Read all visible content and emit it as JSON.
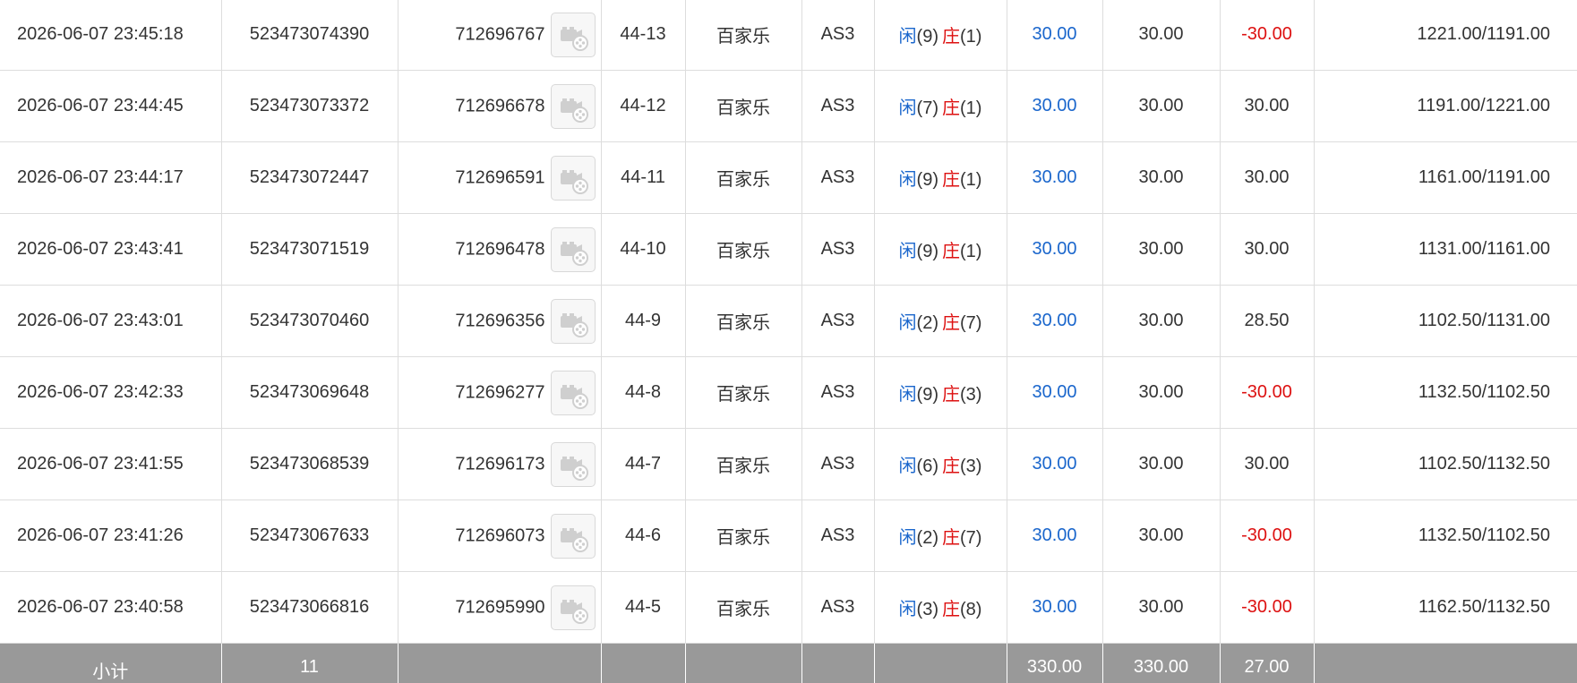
{
  "rows": [
    {
      "time": "2026-06-07 23:45:18",
      "order_no": "523473074390",
      "game_no": "712696767",
      "round": "44-13",
      "game": "百家乐",
      "table": "AS3",
      "result": {
        "player_label": "闲",
        "player_points": "(9)",
        "banker_label": "庄",
        "banker_points": "(1)"
      },
      "bet": "30.00",
      "valid_bet": "30.00",
      "win_loss": "-30.00",
      "win_loss_color": "#dd1111",
      "balance": "1221.00/1191.00"
    },
    {
      "time": "2026-06-07 23:44:45",
      "order_no": "523473073372",
      "game_no": "712696678",
      "round": "44-12",
      "game": "百家乐",
      "table": "AS3",
      "result": {
        "player_label": "闲",
        "player_points": "(7)",
        "banker_label": "庄",
        "banker_points": "(1)"
      },
      "bet": "30.00",
      "valid_bet": "30.00",
      "win_loss": "30.00",
      "win_loss_color": "#333333",
      "balance": "1191.00/1221.00"
    },
    {
      "time": "2026-06-07 23:44:17",
      "order_no": "523473072447",
      "game_no": "712696591",
      "round": "44-11",
      "game": "百家乐",
      "table": "AS3",
      "result": {
        "player_label": "闲",
        "player_points": "(9)",
        "banker_label": "庄",
        "banker_points": "(1)"
      },
      "bet": "30.00",
      "valid_bet": "30.00",
      "win_loss": "30.00",
      "win_loss_color": "#333333",
      "balance": "1161.00/1191.00"
    },
    {
      "time": "2026-06-07 23:43:41",
      "order_no": "523473071519",
      "game_no": "712696478",
      "round": "44-10",
      "game": "百家乐",
      "table": "AS3",
      "result": {
        "player_label": "闲",
        "player_points": "(9)",
        "banker_label": "庄",
        "banker_points": "(1)"
      },
      "bet": "30.00",
      "valid_bet": "30.00",
      "win_loss": "30.00",
      "win_loss_color": "#333333",
      "balance": "1131.00/1161.00"
    },
    {
      "time": "2026-06-07 23:43:01",
      "order_no": "523473070460",
      "game_no": "712696356",
      "round": "44-9",
      "game": "百家乐",
      "table": "AS3",
      "result": {
        "player_label": "闲",
        "player_points": "(2)",
        "banker_label": "庄",
        "banker_points": "(7)"
      },
      "bet": "30.00",
      "valid_bet": "30.00",
      "win_loss": "28.50",
      "win_loss_color": "#333333",
      "balance": "1102.50/1131.00"
    },
    {
      "time": "2026-06-07 23:42:33",
      "order_no": "523473069648",
      "game_no": "712696277",
      "round": "44-8",
      "game": "百家乐",
      "table": "AS3",
      "result": {
        "player_label": "闲",
        "player_points": "(9)",
        "banker_label": "庄",
        "banker_points": "(3)"
      },
      "bet": "30.00",
      "valid_bet": "30.00",
      "win_loss": "-30.00",
      "win_loss_color": "#dd1111",
      "balance": "1132.50/1102.50"
    },
    {
      "time": "2026-06-07 23:41:55",
      "order_no": "523473068539",
      "game_no": "712696173",
      "round": "44-7",
      "game": "百家乐",
      "table": "AS3",
      "result": {
        "player_label": "闲",
        "player_points": "(6)",
        "banker_label": "庄",
        "banker_points": "(3)"
      },
      "bet": "30.00",
      "valid_bet": "30.00",
      "win_loss": "30.00",
      "win_loss_color": "#333333",
      "balance": "1102.50/1132.50"
    },
    {
      "time": "2026-06-07 23:41:26",
      "order_no": "523473067633",
      "game_no": "712696073",
      "round": "44-6",
      "game": "百家乐",
      "table": "AS3",
      "result": {
        "player_label": "闲",
        "player_points": "(2)",
        "banker_label": "庄",
        "banker_points": "(7)"
      },
      "bet": "30.00",
      "valid_bet": "30.00",
      "win_loss": "-30.00",
      "win_loss_color": "#dd1111",
      "balance": "1132.50/1102.50"
    },
    {
      "time": "2026-06-07 23:40:58",
      "order_no": "523473066816",
      "game_no": "712695990",
      "round": "44-5",
      "game": "百家乐",
      "table": "AS3",
      "result": {
        "player_label": "闲",
        "player_points": "(3)",
        "banker_label": "庄",
        "banker_points": "(8)"
      },
      "bet": "30.00",
      "valid_bet": "30.00",
      "win_loss": "-30.00",
      "win_loss_color": "#dd1111",
      "balance": "1162.50/1132.50"
    }
  ],
  "subtotal": {
    "label": "小计",
    "count": "11",
    "bet_total": "330.00",
    "valid_bet_total": "330.00",
    "win_loss_total": "27.00"
  },
  "icons": {
    "replay_icon": "video-replay-icon"
  },
  "colors": {
    "player": "#1a66cc",
    "banker": "#dd1111",
    "bet_amount": "#1a66cc",
    "loss": "#dd1111",
    "subtotal_background": "#999999"
  }
}
